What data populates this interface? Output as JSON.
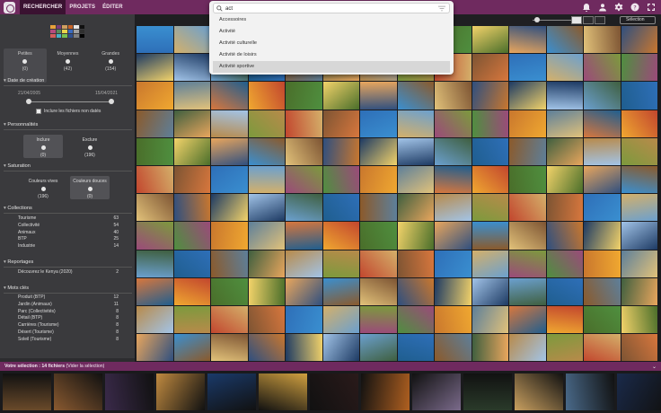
{
  "nav": {
    "tabs": [
      "RECHERCHER",
      "PROJETS",
      "ÉDITER"
    ],
    "active": 0
  },
  "topbar_icons": [
    "bell-icon",
    "user-icon",
    "gear-icon",
    "help-icon",
    "fullscreen-icon"
  ],
  "search": {
    "value": "act",
    "suggestions": [
      "Accessoires",
      "Activité",
      "Activité culturelle",
      "Activité de loisirs",
      "Activité sportive"
    ],
    "highlighted": 4
  },
  "toolbar": {
    "select_label": "Sélection"
  },
  "sidebar": {
    "formats": [
      {
        "label": "Petites",
        "count": "(0)"
      },
      {
        "label": "Moyennes",
        "count": "(42)"
      },
      {
        "label": "Grandes",
        "count": "(154)"
      }
    ],
    "date": {
      "title": "Date de création",
      "from": "21/04/2005",
      "to": "15/04/2021",
      "include_undated": "Inclure les fichiers non datés"
    },
    "people": {
      "title": "Personnalités",
      "options": [
        {
          "label": "Inclure",
          "count": "(0)"
        },
        {
          "label": "Exclure",
          "count": "(196)"
        }
      ]
    },
    "saturation": {
      "title": "Saturation",
      "options": [
        {
          "label": "Couleurs vives",
          "count": "(196)"
        },
        {
          "label": "Couleurs douces",
          "count": "(0)"
        }
      ]
    },
    "collections": {
      "title": "Collections",
      "items": [
        [
          "Tourisme",
          "63"
        ],
        [
          "Collectivité",
          "54"
        ],
        [
          "Animaux",
          "40"
        ],
        [
          "BTP",
          "25"
        ],
        [
          "Industrie",
          "14"
        ]
      ]
    },
    "reportages": {
      "title": "Reportages",
      "items": [
        [
          "Découvrez le Kenya (2020)",
          "2"
        ]
      ]
    },
    "keywords": {
      "title": "Mots clés",
      "items": [
        [
          "Produit (BTP)",
          "12"
        ],
        [
          "Jardin (Animaux)",
          "11"
        ],
        [
          "Parc (Collectivités)",
          "8"
        ],
        [
          "Détail (BTP)",
          "8"
        ],
        [
          "Carrières (Tourisme)",
          "8"
        ],
        [
          "Désert (Tourisme)",
          "8"
        ],
        [
          "Soleil (Tourisme)",
          "8"
        ]
      ]
    }
  },
  "selection": {
    "label": "Votre sélection : 14 fichiers",
    "link": "(Vider la sélection)"
  },
  "colors": {
    "accent": "#6f2a5f",
    "sidebar": "#3a3a3d",
    "background": "#1b1b1e"
  }
}
